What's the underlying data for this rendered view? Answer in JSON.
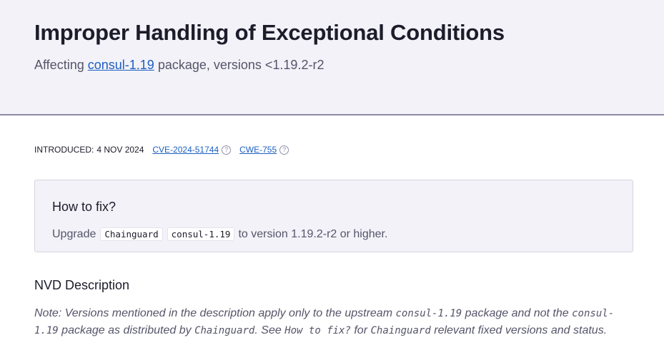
{
  "header": {
    "title": "Improper Handling of Exceptional Conditions",
    "affecting_prefix": "Affecting",
    "package_link": "consul-1.19",
    "affecting_suffix": "package, versions <1.19.2-r2"
  },
  "meta": {
    "introduced_label": "INTRODUCED:",
    "introduced_date": "4 NOV 2024",
    "cve_id": "CVE-2024-51744",
    "cwe_id": "CWE-755",
    "help_icon": "question-circle-icon"
  },
  "fix": {
    "heading": "How to fix?",
    "upgrade_label": "Upgrade",
    "vendor_chip": "Chainguard",
    "package_chip": "consul-1.19",
    "suffix": "to version 1.19.2-r2 or higher."
  },
  "nvd": {
    "heading": "NVD Description",
    "note_1": "Note: Versions mentioned in the description apply only to the upstream",
    "note_pkg_1": "consul-1.19",
    "note_2": "package and not the",
    "note_pkg_2": "consul-1.19",
    "note_3": "package as distributed by",
    "note_vendor_1": "Chainguard",
    "note_4": ". See",
    "note_howto": "How to fix?",
    "note_5": "for",
    "note_vendor_2": "Chainguard",
    "note_6": "relevant fixed versions and status."
  },
  "colors": {
    "link": "#1d5fc2",
    "hero_background": "#f3f2f8",
    "text_muted": "#55556a"
  }
}
